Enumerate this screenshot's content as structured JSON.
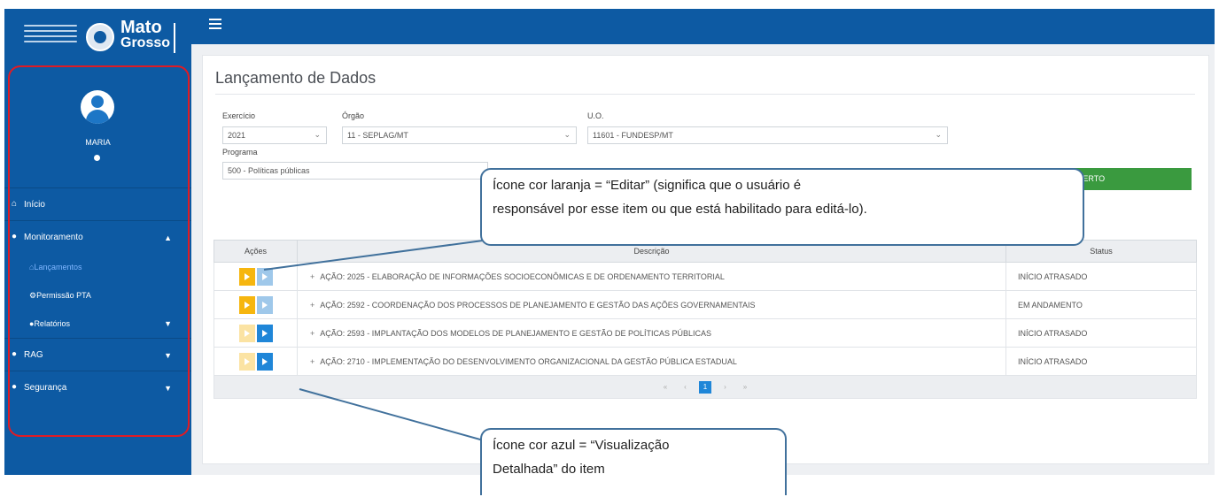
{
  "sidebar": {
    "logo_line1": "Mato",
    "logo_line2": "Grosso",
    "username": "MARIA",
    "nav": {
      "inicio": "Início",
      "monitoramento": "Monitoramento",
      "lancamentos": "Lançamentos",
      "permissao": "Permissão PTA",
      "relatorios": "Relatórios",
      "rag": "RAG",
      "seguranca": "Segurança"
    }
  },
  "page": {
    "title": "Lançamento de Dados"
  },
  "filters": {
    "exercicio_label": "Exercício",
    "exercicio_value": "2021",
    "orgao_label": "Órgão",
    "orgao_value": "11 - SEPLAG/MT",
    "uo_label": "U.O.",
    "uo_value": "11601 - FUNDESP/MT",
    "programa_label": "Programa",
    "programa_value": "500 - Políticas públicas",
    "ciclo_button": "CICLO ABERTO"
  },
  "table": {
    "headers": [
      "Ações",
      "Descrição",
      "Status"
    ],
    "rows": [
      {
        "descricao": "AÇÃO: 2025 - ELABORAÇÃO DE INFORMAÇÕES SOCIOECONÔMICAS E DE ORDENAMENTO TERRITORIAL",
        "status": "INÍCIO ATRASADO"
      },
      {
        "descricao": "AÇÃO: 2592 - COORDENAÇÃO DOS PROCESSOS DE PLANEJAMENTO E GESTÃO DAS AÇÕES GOVERNAMENTAIS",
        "status": "EM ANDAMENTO"
      },
      {
        "descricao": "AÇÃO: 2593 - IMPLANTAÇÃO DOS MODELOS DE PLANEJAMENTO E GESTÃO DE POLÍTICAS PÚBLICAS",
        "status": "INÍCIO ATRASADO"
      },
      {
        "descricao": "AÇÃO: 2710 - IMPLEMENTAÇÃO DO DESENVOLVIMENTO ORGANIZACIONAL DA GESTÃO PÚBLICA ESTADUAL",
        "status": "INÍCIO ATRASADO"
      }
    ],
    "pager": {
      "first": "«",
      "prev": "‹",
      "page": "1",
      "next": "›",
      "last": "»"
    }
  },
  "callouts": {
    "edit_line1": "Ícone cor laranja = “Editar” (significa que o usuário é",
    "edit_line2": "responsável por esse item ou que está habilitado para editá-lo).",
    "view_line1": "Ícone cor azul = “Visualização",
    "view_line2": "Detalhada” do item"
  },
  "colors": {
    "brand_blue": "#0d5aa3",
    "edit_orange": "#f6b60f",
    "view_blue": "#1f86d8",
    "ciclo_green": "#3a9a3f",
    "highlight_red": "#e01b24"
  }
}
